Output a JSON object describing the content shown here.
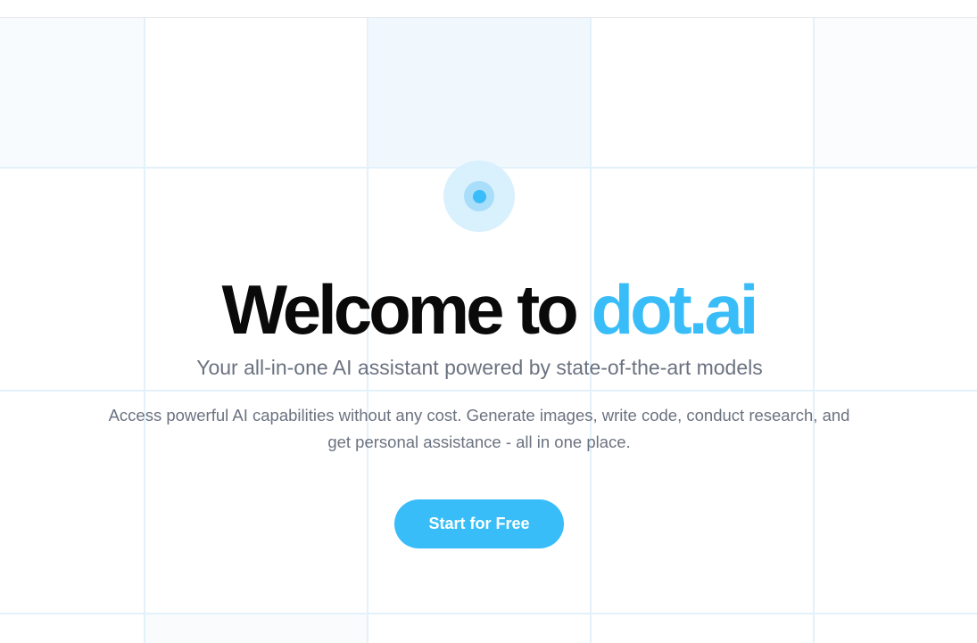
{
  "hero": {
    "title_prefix": "Welcome to ",
    "title_brand": "dot.ai",
    "subtitle": "Your all-in-one AI assistant powered by state-of-the-art models",
    "description": "Access powerful AI capabilities without any cost. Generate images, write code, conduct research, and get personal assistance - all in one place.",
    "cta_label": "Start for Free"
  },
  "colors": {
    "brand": "#38bdf8",
    "title_text": "#0a0a0a",
    "body_text": "#6b7280",
    "grid_line": "#e3f1fb"
  },
  "icons": {
    "logo": "dot-logo-icon"
  }
}
